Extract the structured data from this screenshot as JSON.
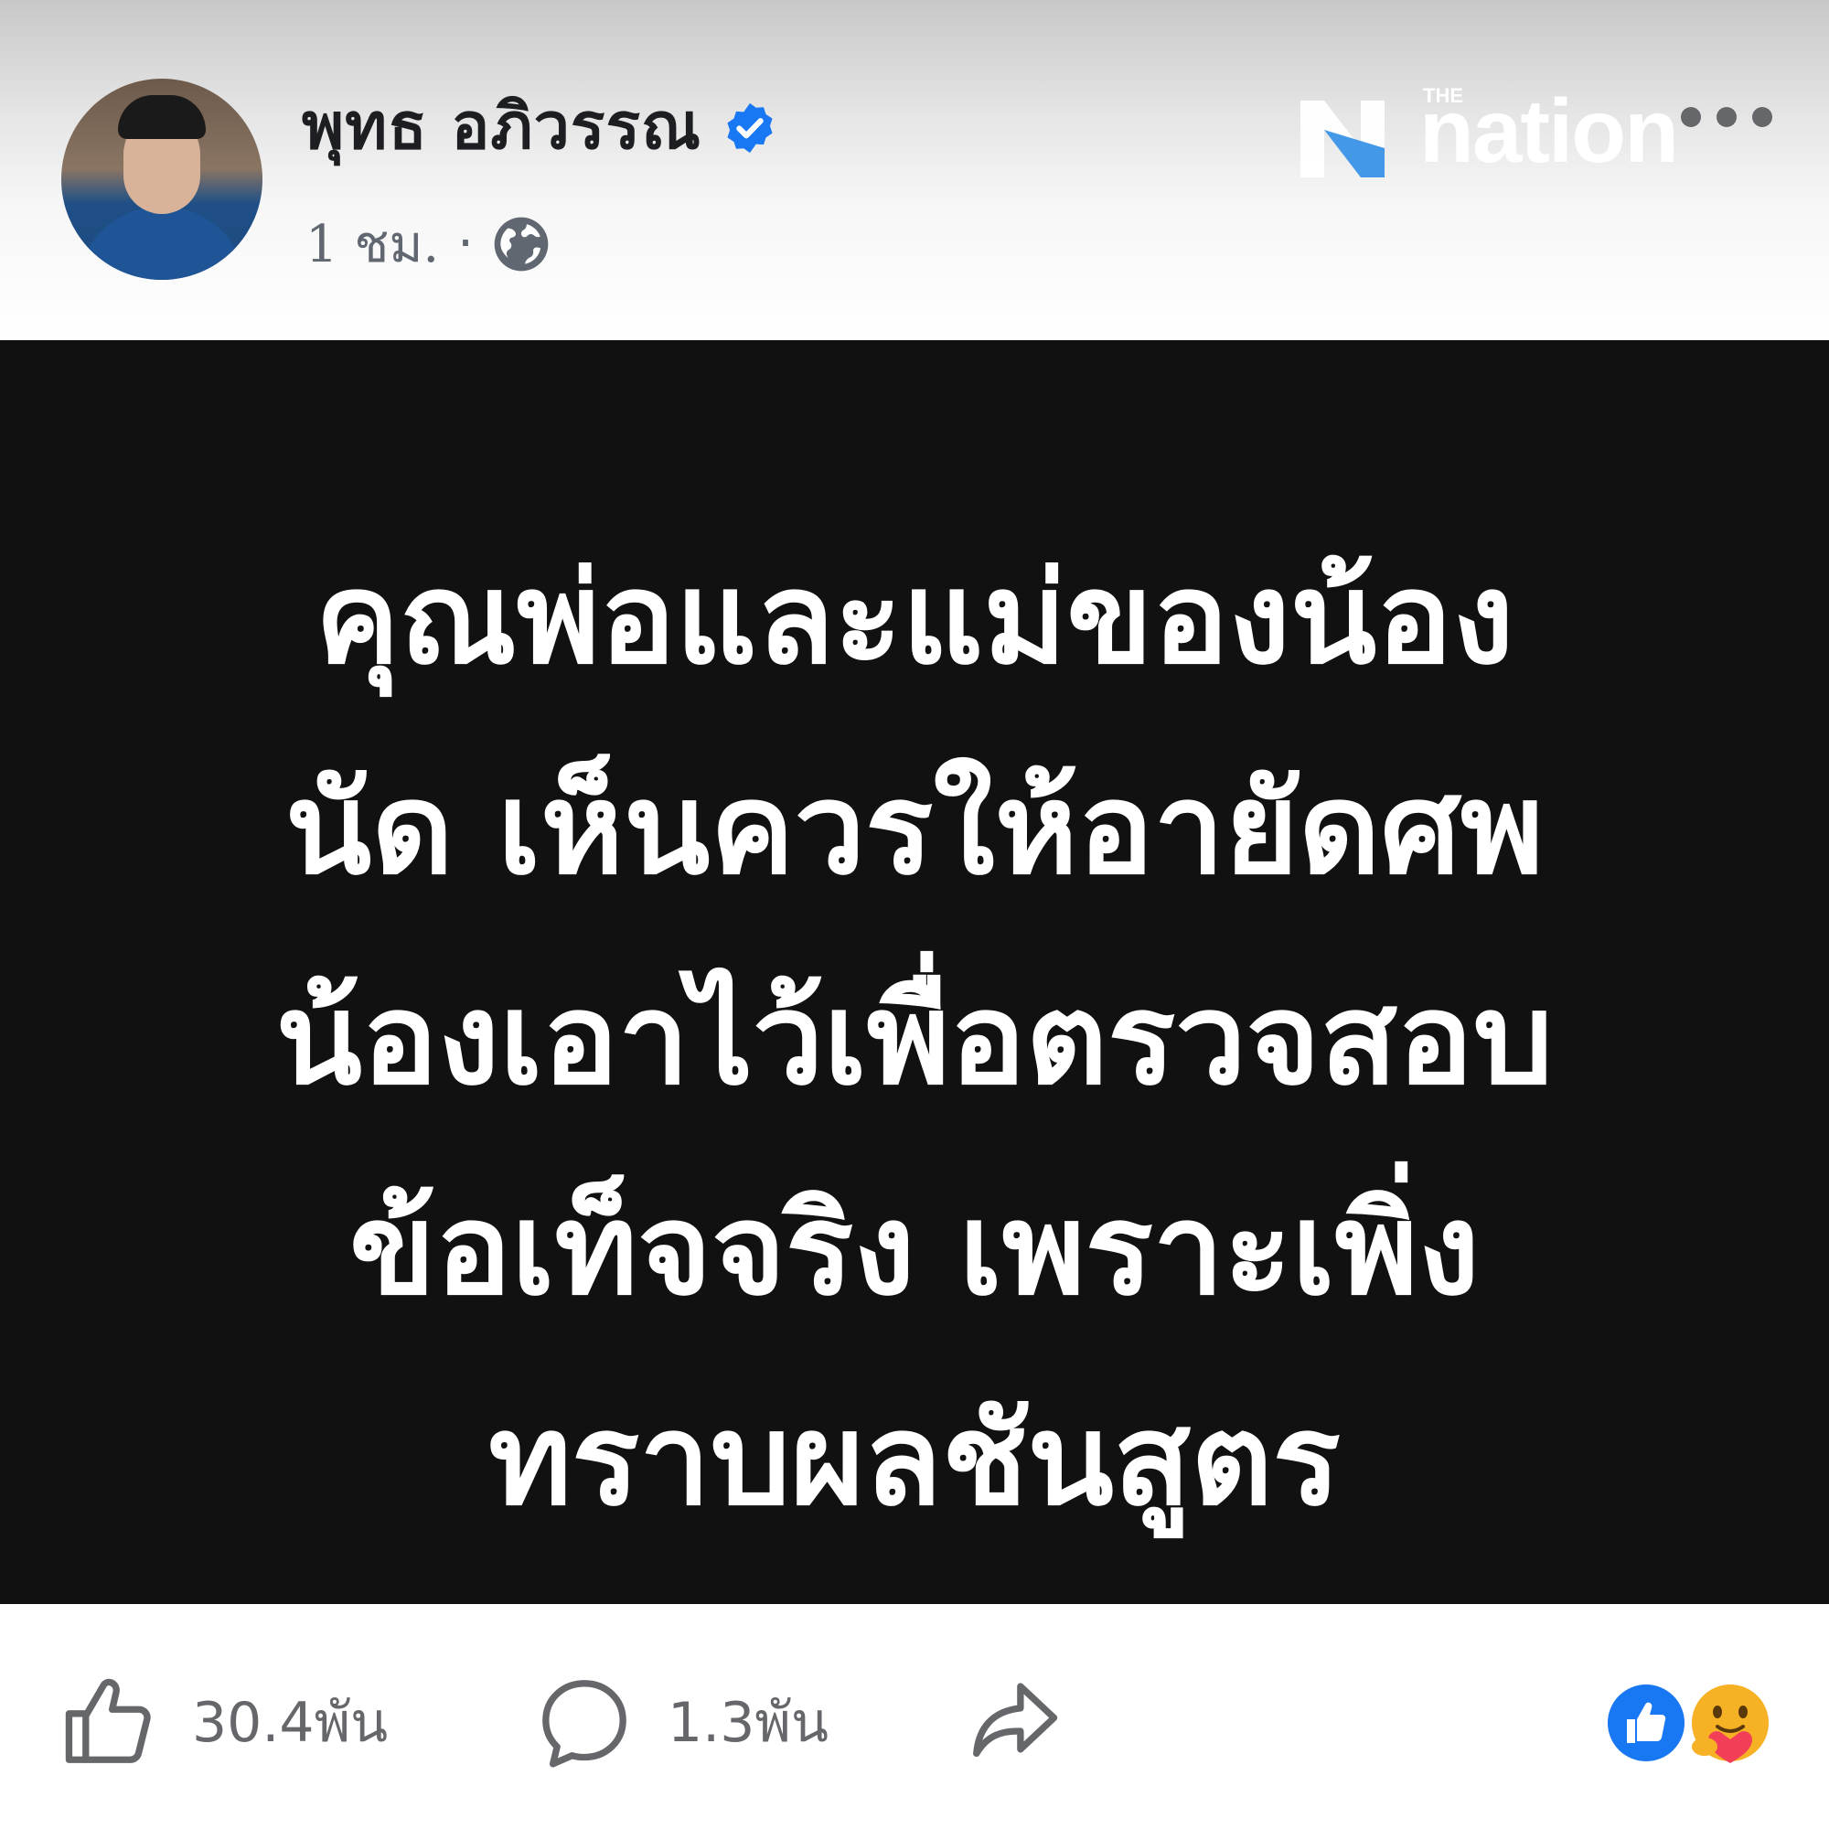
{
  "header": {
    "author_name": "พุทธ อภิวรรณ",
    "timestamp": "1 ชม.",
    "separator": "·",
    "audience_icon": "globe-icon",
    "verified_icon": "verified-badge-icon",
    "watermark": {
      "small": "THE",
      "main": "nation"
    },
    "more_icon": "more-options-icon"
  },
  "post": {
    "background_color": "#111111",
    "text_color": "#ffffff",
    "lines": [
      "คุณพ่อและแม่ของน้อง",
      "นัด เห็นควรให้อายัดศพ",
      "น้องเอาไว้เพื่อตรวจสอบ",
      "ข้อเท็จจริง เพราะเพิ่ง",
      "ทราบผลชันสูตร"
    ]
  },
  "footer": {
    "like_count": "30.4พัน",
    "comment_count": "1.3พัน",
    "like_icon": "thumbs-up-icon",
    "comment_icon": "comment-icon",
    "share_icon": "share-icon",
    "reaction_icons": [
      "like-reaction-icon",
      "care-reaction-icon"
    ],
    "accent_color": "#1877f2"
  }
}
